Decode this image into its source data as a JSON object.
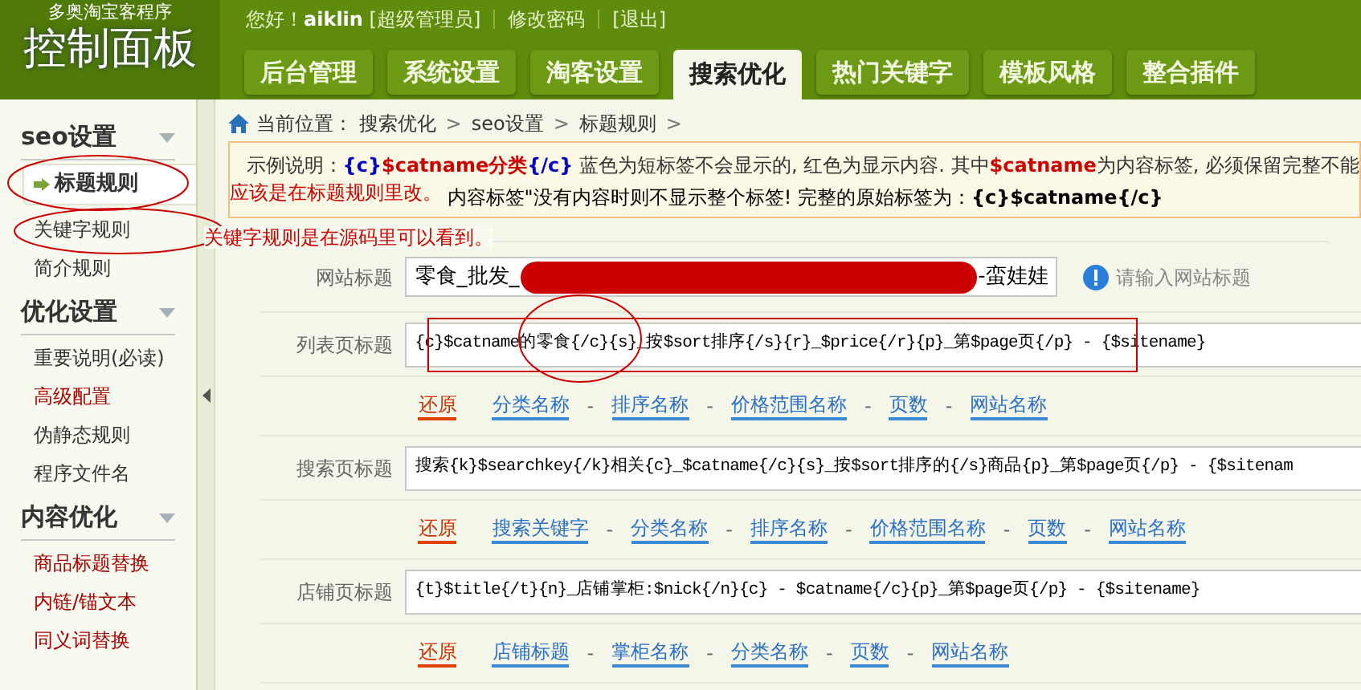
{
  "logo": {
    "subtitle": "多奥淘宝客程序",
    "title": "控制面板"
  },
  "user_bar": {
    "greeting": "您好！",
    "username": "aiklin",
    "role": "[超级管理员]",
    "links": [
      "修改密码",
      "[退出]"
    ]
  },
  "tabs": [
    {
      "label": "后台管理",
      "selected": false
    },
    {
      "label": "系统设置",
      "selected": false
    },
    {
      "label": "淘客设置",
      "selected": false
    },
    {
      "label": "搜索优化",
      "selected": true
    },
    {
      "label": "热门关键字",
      "selected": false
    },
    {
      "label": "模板风格",
      "selected": false
    },
    {
      "label": "整合插件",
      "selected": false
    }
  ],
  "sidebar": {
    "sections": [
      {
        "title": "seo设置",
        "items": [
          {
            "label": "标题规则",
            "selected": true,
            "color": "#333333"
          },
          {
            "label": "关键字规则",
            "selected": false,
            "color": "#333333"
          },
          {
            "label": "简介规则",
            "selected": false,
            "color": "#333333"
          }
        ]
      },
      {
        "title": "优化设置",
        "items": [
          {
            "label": "重要说明(必读)",
            "selected": false,
            "color": "#333333"
          },
          {
            "label": "高级配置",
            "selected": false,
            "color": "#aa0000"
          },
          {
            "label": "伪静态规则",
            "selected": false,
            "color": "#333333"
          },
          {
            "label": "程序文件名",
            "selected": false,
            "color": "#333333"
          }
        ]
      },
      {
        "title": "内容优化",
        "items": [
          {
            "label": "商品标题替换",
            "selected": false,
            "color": "#aa0000"
          },
          {
            "label": "内链/锚文本",
            "selected": false,
            "color": "#aa0000"
          },
          {
            "label": "同义词替换",
            "selected": false,
            "color": "#aa0000"
          }
        ]
      }
    ]
  },
  "breadcrumb": {
    "label": "当前位置：",
    "items": [
      "搜索优化",
      "seo设置",
      "标题规则"
    ],
    "separator": ">"
  },
  "info": {
    "line1": [
      {
        "kind": "plain",
        "text": "示例说明："
      },
      {
        "kind": "tag",
        "text": "{c}"
      },
      {
        "kind": "content",
        "text": "$catname分类"
      },
      {
        "kind": "tag",
        "text": "{/c}"
      },
      {
        "kind": "plain",
        "text": " 蓝色为短标签不会显示的, 红色为显示内容. 其中"
      },
      {
        "kind": "content",
        "text": "$catname"
      },
      {
        "kind": "plain",
        "text": "为内容标签, 必须保留完整不能"
      }
    ],
    "line2": "内容标签\"没有内容时则不显示整个标签!   完整的原始标签为：**{c}$catname{/c}**"
  },
  "form": {
    "site_title": {
      "label": "网站标题",
      "value_start": "零食_批发_",
      "value_end": "-蛮娃娃",
      "hint": "请输入网站标题"
    },
    "rows": [
      {
        "label": "列表页标题",
        "value": "{c}$catname的零食{/c}{s}_按$sort排序{/s}{r}_$price{/r}{p}_第$page页{/p} - {$sitename}",
        "separator": "-",
        "links": [
          {
            "kind": "reset",
            "text": "还原"
          },
          {
            "kind": "tag",
            "text": "分类名称"
          },
          {
            "kind": "tag",
            "text": "排序名称"
          },
          {
            "kind": "tag",
            "text": "价格范围名称"
          },
          {
            "kind": "tag",
            "text": "页数"
          },
          {
            "kind": "tag",
            "text": "网站名称"
          }
        ]
      },
      {
        "label": "搜索页标题",
        "value": "搜索{k}$searchkey{/k}相关{c}_$catname{/c}{s}_按$sort排序的{/s}商品{p}_第$page页{/p} - {$sitenam",
        "separator": "-",
        "links": [
          {
            "kind": "reset",
            "text": "还原"
          },
          {
            "kind": "tag",
            "text": "搜索关键字"
          },
          {
            "kind": "tag",
            "text": "分类名称"
          },
          {
            "kind": "tag",
            "text": "排序名称"
          },
          {
            "kind": "tag",
            "text": "价格范围名称"
          },
          {
            "kind": "tag",
            "text": "页数"
          },
          {
            "kind": "tag",
            "text": "网站名称"
          }
        ]
      },
      {
        "label": "店铺页标题",
        "value": "{t}$title{/t}{n}_店铺掌柜:$nick{/n}{c} - $catname{/c}{p}_第$page页{/p} - {$sitename}",
        "separator": "-",
        "links": [
          {
            "kind": "reset",
            "text": "还原"
          },
          {
            "kind": "tag",
            "text": "店铺标题"
          },
          {
            "kind": "tag",
            "text": "掌柜名称"
          },
          {
            "kind": "tag",
            "text": "分类名称"
          },
          {
            "kind": "tag",
            "text": "页数"
          },
          {
            "kind": "tag",
            "text": "网站名称"
          }
        ]
      }
    ]
  },
  "annotations": [
    "应该是在标题规则里改。",
    "关键字规则是在源码里可以看到。"
  ]
}
